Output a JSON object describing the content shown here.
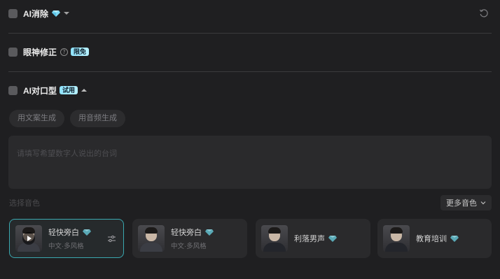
{
  "options": [
    {
      "label": "AI消除",
      "checked": false
    },
    {
      "label": "眼神修正",
      "badge": "限免",
      "checked": false
    },
    {
      "label": "AI对口型",
      "badge": "试用",
      "checked": false
    }
  ],
  "generate_tabs": [
    "用文案生成",
    "用音频生成"
  ],
  "script_placeholder": "请填写希望数字人说出的台词",
  "voice_section": {
    "label": "选择音色",
    "more_button": "更多音色"
  },
  "voices": [
    {
      "name": "轻快旁白",
      "tag": "中文·多风格",
      "selected": true
    },
    {
      "name": "轻快旁白",
      "tag": "中文·多风格",
      "selected": false
    },
    {
      "name": "利落男声",
      "tag": "",
      "selected": false
    },
    {
      "name": "教育培训",
      "tag": "",
      "selected": false
    }
  ],
  "colors": {
    "accent": "#3aa8b0",
    "badge": "#8fe3ff",
    "background": "#1f1f21"
  },
  "icons": [
    "diamond-icon",
    "help-icon",
    "reset-icon",
    "play-icon",
    "adjust-icon",
    "chevron-down-icon"
  ]
}
